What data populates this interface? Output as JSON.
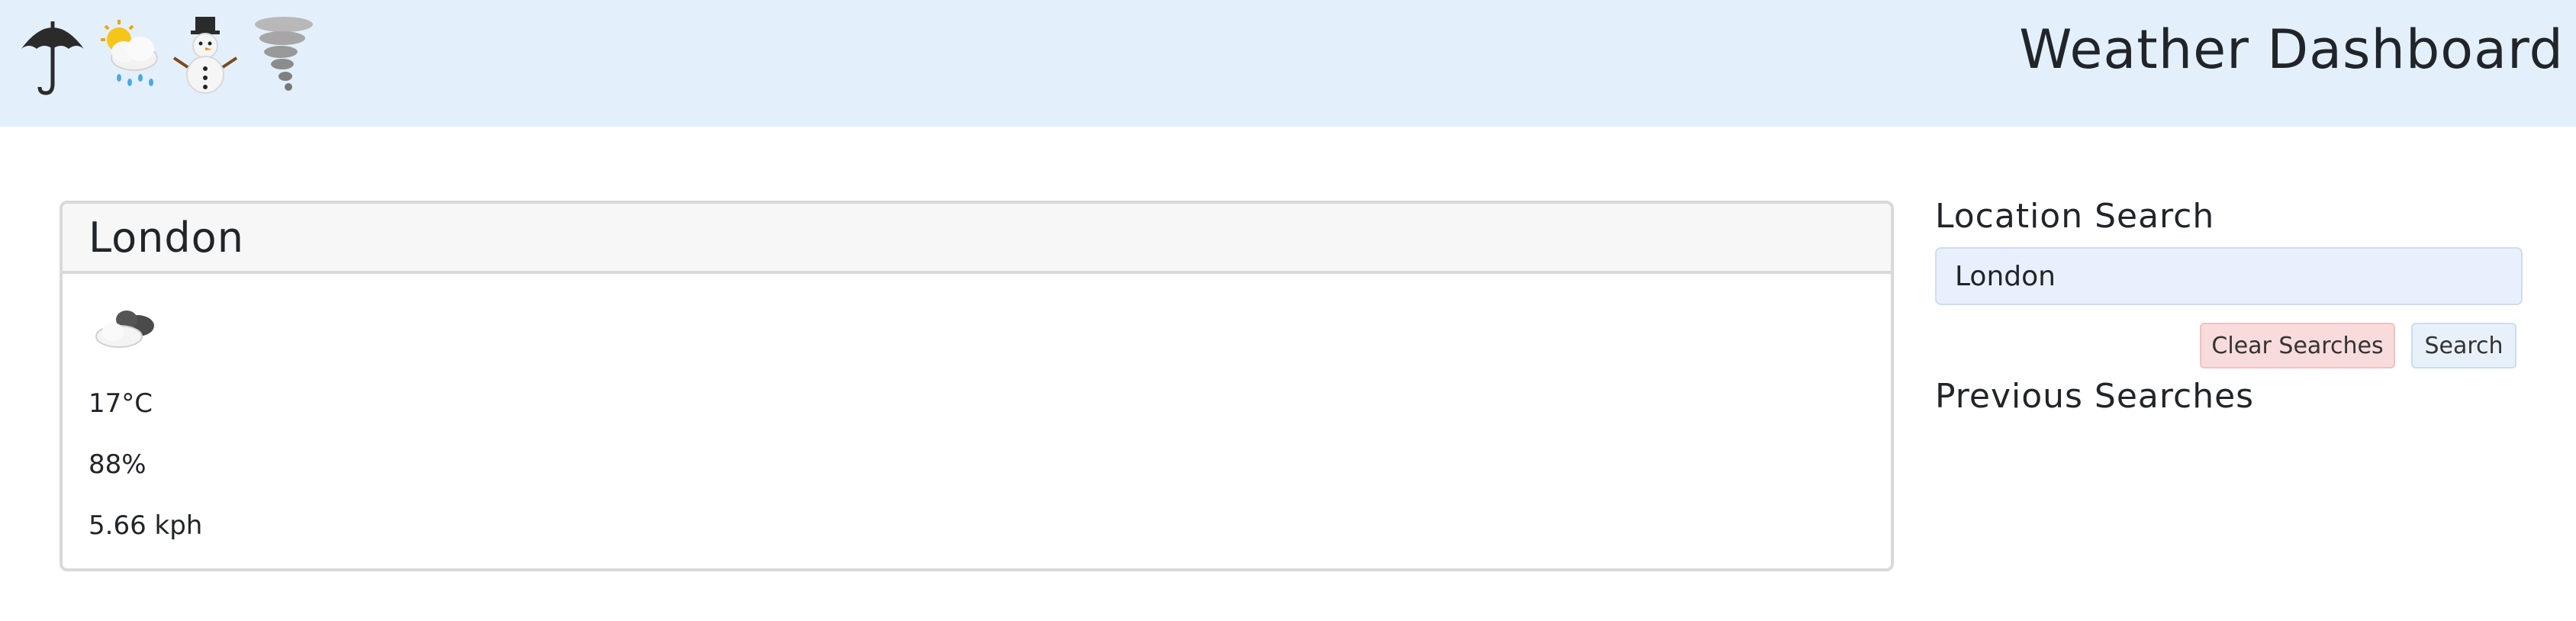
{
  "header": {
    "title": "Weather Dashboard",
    "icons": [
      "umbrella-icon",
      "sun-behind-rain-cloud-icon",
      "snowman-icon",
      "tornado-icon"
    ]
  },
  "current": {
    "city": "London",
    "condition_icon": "cloud-icon",
    "temperature": "17°C",
    "humidity": "88%",
    "wind": "5.66 kph"
  },
  "search": {
    "label": "Location Search",
    "value": "London",
    "clear_label": "Clear Searches",
    "search_label": "Search",
    "previous_label": "Previous Searches"
  },
  "colors": {
    "header_bg": "#e3f0fb",
    "input_bg": "#e8f0fe",
    "clear_btn_bg": "#f8dbdb",
    "search_btn_bg": "#e8f1fa"
  }
}
